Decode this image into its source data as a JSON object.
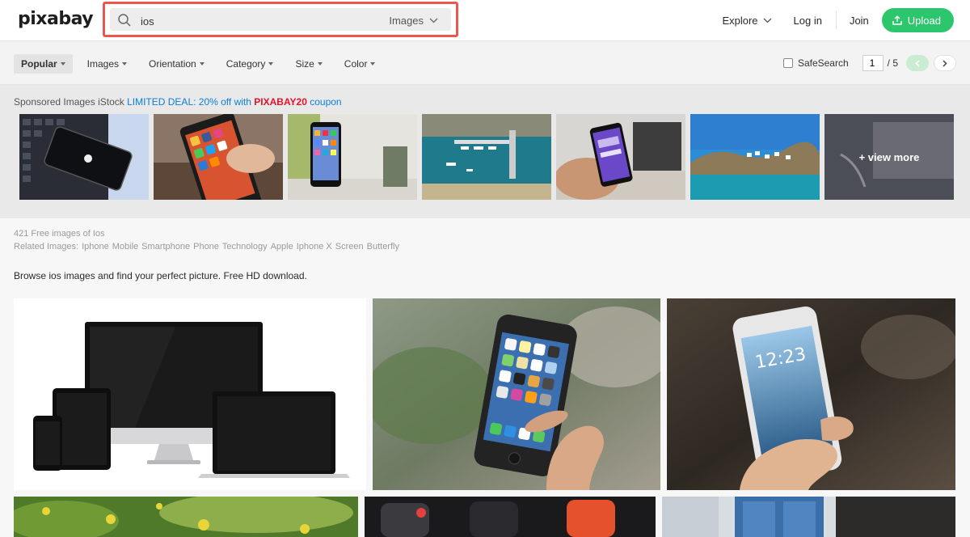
{
  "header": {
    "logo": "pixabay",
    "search_value": "ios",
    "search_type": "Images",
    "nav": {
      "explore": "Explore",
      "login": "Log in",
      "join": "Join",
      "upload": "Upload"
    }
  },
  "filters": {
    "items": [
      {
        "label": "Popular",
        "active": true
      },
      {
        "label": "Images"
      },
      {
        "label": "Orientation"
      },
      {
        "label": "Category"
      },
      {
        "label": "Size"
      },
      {
        "label": "Color"
      }
    ],
    "safesearch": "SafeSearch",
    "page_current": "1",
    "page_total": "/ 5"
  },
  "sponsored": {
    "prefix": "Sponsored Images iStock",
    "deal": "LIMITED DEAL: 20% off with",
    "code": "PIXABAY20",
    "suffix": "coupon",
    "view_more": "+ view more"
  },
  "info": {
    "count": "421 Free images of Ios",
    "related_label": "Related Images:",
    "related": [
      "Iphone",
      "Mobile",
      "Smartphone",
      "Phone",
      "Technology",
      "Apple",
      "Iphone X",
      "Screen",
      "Butterfly"
    ],
    "browse": "Browse ios images and find your perfect picture. Free HD download."
  },
  "results": {
    "lockscreen_time": "12:23"
  },
  "colors": {
    "accent": "#2ec66d",
    "highlight": "#e8584f",
    "deal": "#0b7fd6",
    "code": "#e5122a"
  }
}
